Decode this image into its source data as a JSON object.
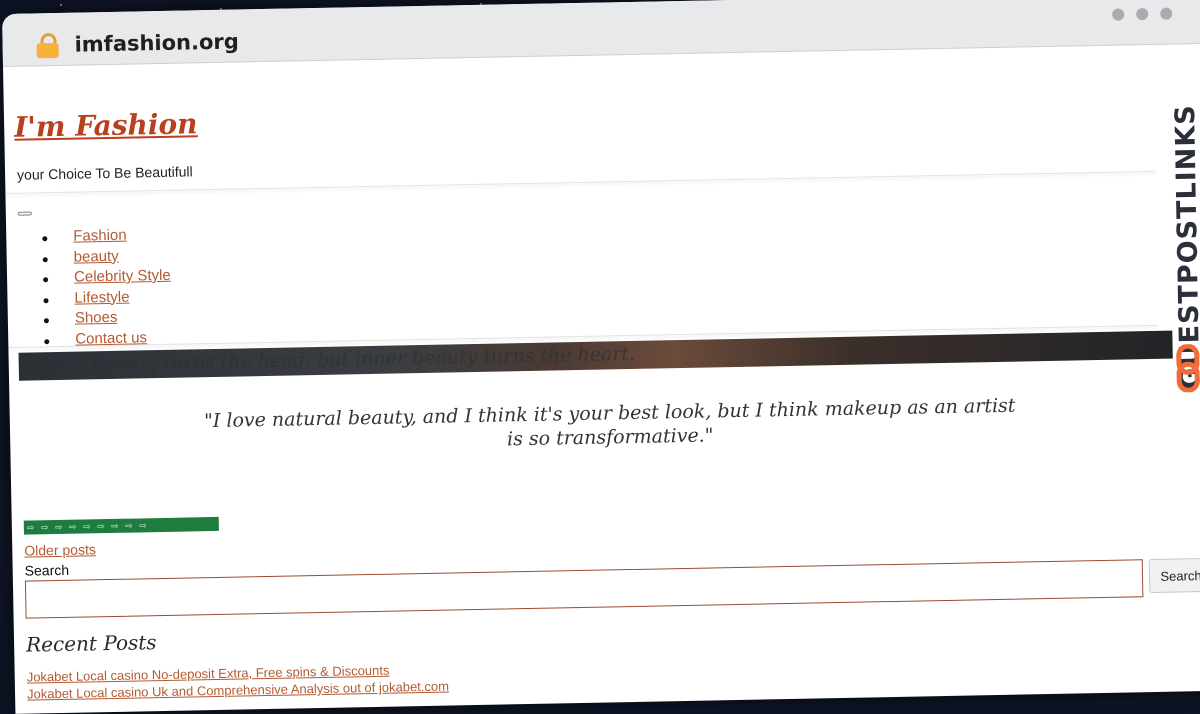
{
  "browser": {
    "url": "imfashion.org"
  },
  "site": {
    "title": "I'm Fashion",
    "tagline": "your Choice To Be Beautifull"
  },
  "nav": {
    "items": [
      {
        "label": "Fashion"
      },
      {
        "label": "beauty"
      },
      {
        "label": "Celebrity Style"
      },
      {
        "label": "Lifestyle"
      },
      {
        "label": "Shoes"
      },
      {
        "label": "Contact us"
      }
    ]
  },
  "banner": {
    "text": "Outer beauty turns the head, but inner beauty turns the heart."
  },
  "quote": {
    "text": "\"I love natural beauty, and I think it's your best look, but I think makeup as an artist is so transformative.\""
  },
  "green_strip": {
    "text": "⇨ ⇨ ⇨ ⇨ ⇨ ⇨ ⇨ ⇨ ⇨"
  },
  "pagination": {
    "older_label": "Older posts"
  },
  "search": {
    "label": "Search",
    "button_label": "Search",
    "value": ""
  },
  "recent_posts": {
    "title": "Recent Posts",
    "items": [
      {
        "label": "Jokabet Local casino No-deposit Extra, Free spins & Discounts"
      },
      {
        "label": "Jokabet Local casino Uk and Comprehensive Analysis out of jokabet.com"
      }
    ]
  },
  "watermark": {
    "text": "GUESTPOSTLINKS"
  },
  "colors": {
    "accent": "#b45a32",
    "title": "#b8401e",
    "logo_orange": "#f26b3a"
  }
}
